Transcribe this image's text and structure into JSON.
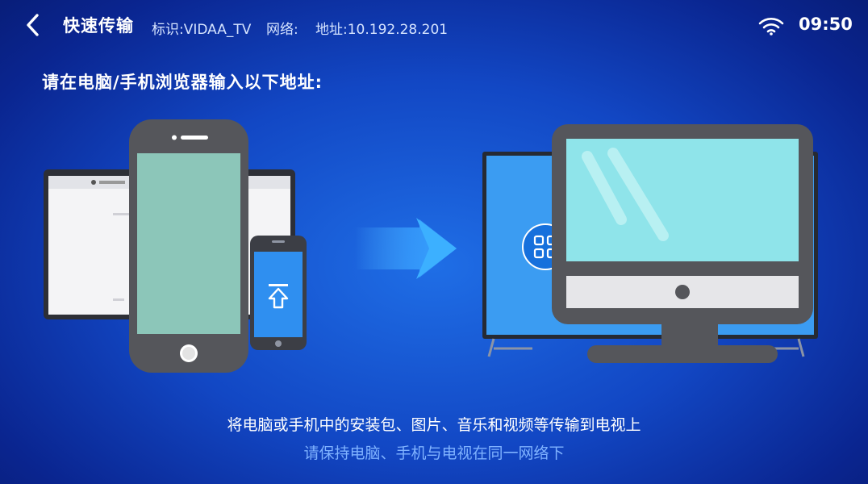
{
  "header": {
    "title": "快速传输",
    "id_text": "标识:VIDAA_TV",
    "network_label": "网络:",
    "address_text": "地址:10.192.28.201",
    "time": "09:50"
  },
  "main": {
    "instruction": "请在电脑/手机浏览器输入以下地址:",
    "caption_main": "将电脑或手机中的安装包、图片、音乐和视频等传输到电视上",
    "caption_sub": "请保持电脑、手机与电视在同一网络下"
  },
  "icons": {
    "back": "chevron-left-icon",
    "wifi": "wifi-icon",
    "arrow": "arrow-right-icon",
    "upload": "upload-icon",
    "grid": "grid-icon"
  },
  "colors": {
    "background": "#1247c4",
    "device_body": "#55565b",
    "phone_screen": "#8cc6b9",
    "monitor_screen": "#8fe4ea",
    "tv_screen": "#3b9cf2",
    "caption_sub": "#7fb2ff"
  }
}
